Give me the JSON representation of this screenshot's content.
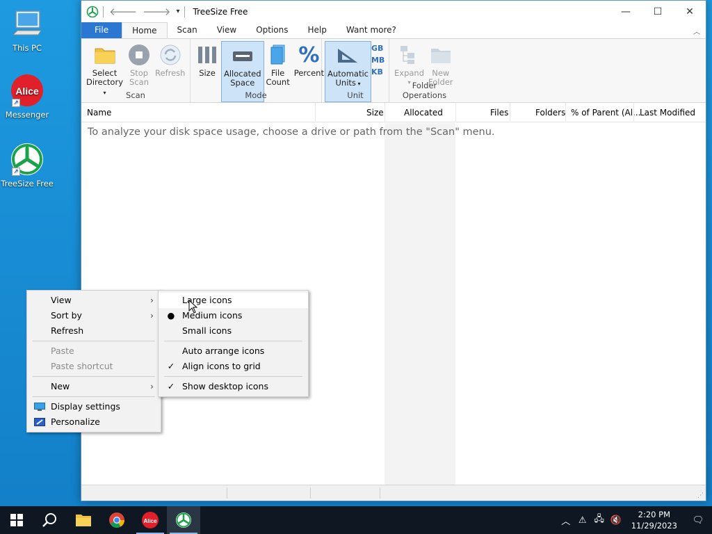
{
  "desktop": {
    "icons": [
      {
        "label": "This PC"
      },
      {
        "label": "Messenger",
        "logo_text": "Alice"
      },
      {
        "label": "TreeSize Free"
      }
    ]
  },
  "window": {
    "title": "TreeSize Free",
    "tabs": [
      "File",
      "Home",
      "Scan",
      "View",
      "Options",
      "Help",
      "Want more?"
    ],
    "active_tab": "Home",
    "ribbon": {
      "scan": {
        "label": "Scan",
        "select_directory": [
          "Select",
          "Directory"
        ],
        "stop_scan": [
          "Stop",
          "Scan"
        ],
        "refresh": "Refresh"
      },
      "mode": {
        "label": "Mode",
        "size": "Size",
        "allocated_space": [
          "Allocated",
          "Space"
        ],
        "file_count": [
          "File",
          "Count"
        ],
        "percent": "Percent"
      },
      "unit": {
        "label": "Unit",
        "automatic_units": [
          "Automatic",
          "Units"
        ],
        "gb": "GB",
        "mb": "MB",
        "kb": "KB"
      },
      "folder_operations": {
        "label": "Folder Operations",
        "expand": "Expand",
        "new_folder": [
          "New",
          "Folder"
        ]
      }
    },
    "columns": {
      "name": "Name",
      "size": "Size",
      "allocated": "Allocated",
      "files": "Files",
      "folders": "Folders",
      "percent_parent": "% of Parent (Al...",
      "last_modified": "Last Modified"
    },
    "hint": "To analyze your disk space usage, choose a drive or path from the \"Scan\" menu."
  },
  "context_menu": {
    "items": [
      "View",
      "Sort by",
      "Refresh",
      "Paste",
      "Paste shortcut",
      "New",
      "Display settings",
      "Personalize"
    ]
  },
  "view_submenu": {
    "items": [
      "Large icons",
      "Medium icons",
      "Small icons",
      "Auto arrange icons",
      "Align icons to grid",
      "Show desktop icons"
    ]
  },
  "taskbar": {
    "time": "2:20 PM",
    "date": "11/29/2023"
  },
  "colors": {
    "accent": "#2b78d3",
    "desktop": "#1a8fd6",
    "treesize_green": "#1aa34a",
    "alice_red": "#e0202a"
  }
}
